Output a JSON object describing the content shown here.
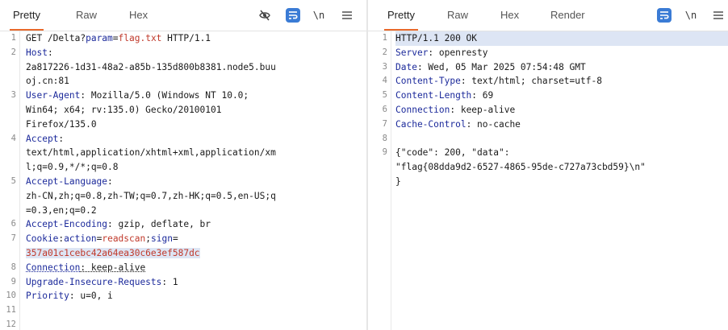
{
  "request_pane": {
    "tabs": [
      "Pretty",
      "Raw",
      "Hex"
    ],
    "active_tab": "Pretty",
    "tools": {
      "wrap_icon": "hide-whitespace-icon",
      "format_icon": "format-icon",
      "newline_label": "\\n",
      "menu_icon": "hamburger-menu-icon"
    },
    "line_numbers": [
      "1",
      "2",
      "3",
      "4",
      "5",
      "6",
      "7",
      "8",
      "9",
      "10",
      "11",
      "12"
    ],
    "lines": {
      "l1_method": "GET /Delta?",
      "l1_pname": "param",
      "l1_eq": "=",
      "l1_pval": "flag.txt",
      "l1_rest": " HTTP/1.1",
      "l2_key": "Host",
      "l2_colon": ":",
      "l2_val_a": "2a817226-1d31-48a2-a85b-135d800b8381.node5.buu",
      "l2_val_b": "oj.cn:81",
      "l3_key": "User-Agent",
      "l3_val_a": ": Mozilla/5.0 (Windows NT 10.0;",
      "l3_val_b": "Win64; x64; rv:135.0) Gecko/20100101",
      "l3_val_c": "Firefox/135.0",
      "l4_key": "Accept",
      "l4_colon": ":",
      "l4_val_a": "text/html,application/xhtml+xml,application/xm",
      "l4_val_b": "l;q=0.9,*/*;q=0.8",
      "l5_key": "Accept-Language",
      "l5_colon": ":",
      "l5_val_a": "zh-CN,zh;q=0.8,zh-TW;q=0.7,zh-HK;q=0.5,en-US;q",
      "l5_val_b": "=0.3,en;q=0.2",
      "l6_key": "Accept-Encoding",
      "l6_val": ": gzip, deflate, br",
      "l7_key": "Cookie",
      "l7_colon": ":",
      "l7_c1": "action",
      "l7_eq1": "=",
      "l7_v1": "readscan",
      "l7_semi": ";",
      "l7_c2": "sign",
      "l7_eq2": "=",
      "l7_v2": "357a01c1cebc42a64ea30c6e3ef587dc",
      "l8_key": "Connection",
      "l8_val": ": keep-alive",
      "l9_key": "Upgrade-Insecure-Requests",
      "l9_val": ": 1",
      "l10_key": "Priority",
      "l10_val": ": u=0, i"
    }
  },
  "response_pane": {
    "tabs": [
      "Pretty",
      "Raw",
      "Hex",
      "Render"
    ],
    "active_tab": "Pretty",
    "tools": {
      "format_icon": "format-icon",
      "newline_label": "\\n",
      "menu_icon": "hamburger-menu-icon"
    },
    "line_numbers": [
      "1",
      "2",
      "3",
      "4",
      "5",
      "6",
      "7",
      "8",
      "9"
    ],
    "lines": {
      "r1": "HTTP/1.1 200 OK",
      "r2_key": "Server",
      "r2_val": ": openresty",
      "r3_key": "Date",
      "r3_val": ": Wed, 05 Mar 2025 07:54:48 GMT",
      "r4_key": "Content-Type",
      "r4_val": ": text/html; charset=utf-8",
      "r5_key": "Content-Length",
      "r5_val": ": 69",
      "r6_key": "Connection",
      "r6_val": ": keep-alive",
      "r7_key": "Cache-Control",
      "r7_val": ": no-cache",
      "r9_a": "{\"code\": 200, \"data\":",
      "r9_b": "\"flag{08dda9d2-6527-4865-95de-c727a73cbd59}\\n\"",
      "r9_c": "}"
    }
  },
  "colors": {
    "accent_tab": "#e8692b",
    "header_key": "#1c2a9b",
    "param_value": "#c0392b",
    "format_button": "#3a7bd5",
    "highlight": "#dde5f4"
  }
}
